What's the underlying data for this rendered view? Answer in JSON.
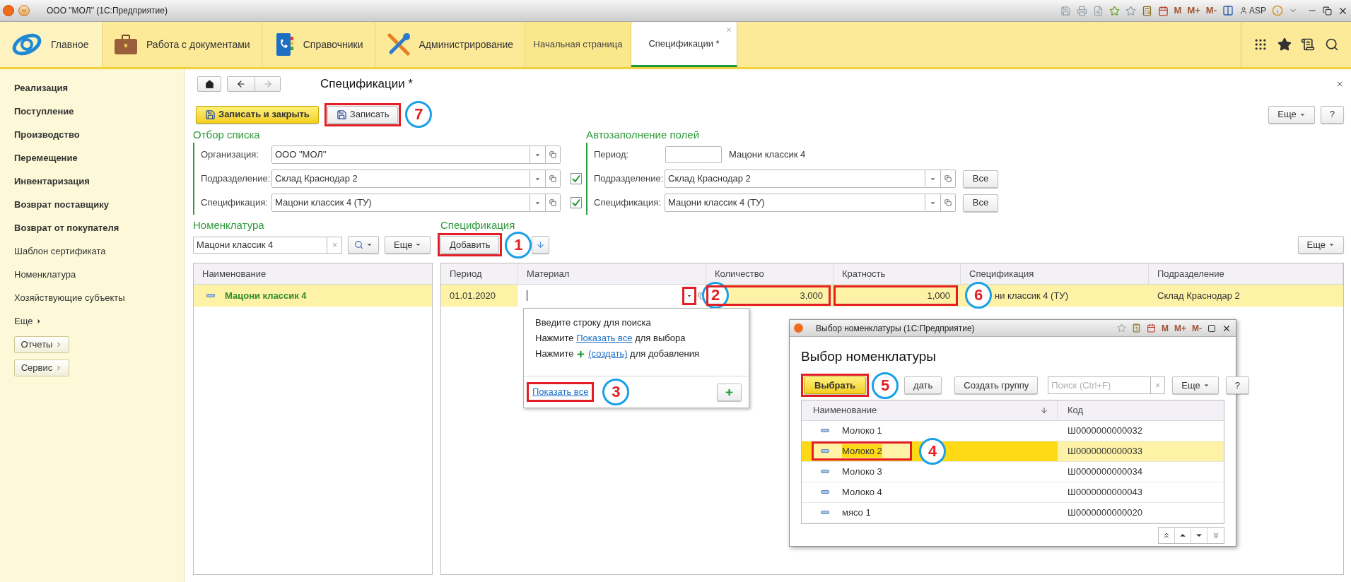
{
  "window": {
    "title": "ООО \"МОЛ\"  (1С:Предприятие)",
    "memory_buttons": [
      "M",
      "M+",
      "M-"
    ],
    "user": "ASP"
  },
  "sections": [
    {
      "label": "Главное",
      "kind": "home",
      "selected": true
    },
    {
      "label": "Работа с документами",
      "kind": "briefcase",
      "selected": false
    },
    {
      "label": "Справочники",
      "kind": "book",
      "selected": false
    },
    {
      "label": "Администрирование",
      "kind": "tools",
      "selected": false
    }
  ],
  "open_tabs": [
    {
      "label": "Начальная страница",
      "selected": false
    },
    {
      "label": "Спецификации *",
      "selected": true
    }
  ],
  "sidebar": {
    "items": [
      {
        "label": "Реализация",
        "kind": "section"
      },
      {
        "label": "Поступление",
        "kind": "section"
      },
      {
        "label": "Производство",
        "kind": "section"
      },
      {
        "label": "Перемещение",
        "kind": "section"
      },
      {
        "label": "Инвентаризация",
        "kind": "section"
      },
      {
        "label": "Возврат поставщику",
        "kind": "section"
      },
      {
        "label": "Возврат от покупателя",
        "kind": "section"
      },
      {
        "label": "Шаблон сертификата",
        "kind": "link"
      },
      {
        "label": "Номенклатура",
        "kind": "link"
      },
      {
        "label": "Хозяйствующие субъекты",
        "kind": "link"
      },
      {
        "label": "Еще",
        "kind": "more"
      },
      {
        "label": "Отчеты",
        "kind": "button"
      },
      {
        "label": "Сервис",
        "kind": "button"
      }
    ]
  },
  "form": {
    "title": "Спецификации *",
    "commands": [
      {
        "label": "Записать и закрыть",
        "kind": "default",
        "marked": false
      },
      {
        "label": "Записать",
        "kind": "normal",
        "marked": true,
        "callout": "7"
      }
    ],
    "more": "Еще",
    "help": "?"
  },
  "filter": {
    "title": "Отбор списка",
    "fields": [
      {
        "label": "Организация:",
        "value": "ООО \"МОЛ\"",
        "kind": "plain"
      },
      {
        "label": "Подразделение:",
        "value": "Склад Краснодар 2",
        "kind": "checkbox",
        "checked": true
      },
      {
        "label": "Спецификация:",
        "value": "Мацони классик 4 (ТУ)",
        "kind": "checkbox",
        "checked": true
      }
    ]
  },
  "autofill": {
    "title": "Автозаполнение полей",
    "period": {
      "label": "Период:",
      "note": "Мацони классик 4"
    },
    "fields": [
      {
        "label": "Подразделение:",
        "value": "Склад Краснодар 2",
        "button": "Все"
      },
      {
        "label": "Спецификация:",
        "value": "Мацони классик 4 (ТУ)",
        "button": "Все"
      }
    ]
  },
  "nomenclature": {
    "title": "Номенклатура",
    "search": {
      "value": "Мацони классик 4"
    },
    "more": "Еще",
    "columns": [
      "Наименование"
    ],
    "rows": [
      {
        "name": "Мацони классик 4",
        "selected": true
      }
    ]
  },
  "specification": {
    "title": "Спецификация",
    "add": {
      "label": "Добавить",
      "marked": true,
      "callout": "1"
    },
    "more": "Еще",
    "columns": [
      "Период",
      "Материал",
      "Количество",
      "Кратность",
      "Спецификация",
      "Подразделение"
    ],
    "rows": [
      {
        "selected": true,
        "cells": [
          {
            "kind": "text",
            "text": "01.01.2020",
            "marked": false
          },
          {
            "kind": "input",
            "editing": true,
            "button_marked": true,
            "callout": "2"
          },
          {
            "kind": "number",
            "text": "3,000",
            "marked": true
          },
          {
            "kind": "number",
            "text": "1,000",
            "marked": true
          },
          {
            "kind": "text",
            "text": "ни классик 4 (ТУ)",
            "marked": false,
            "callout": "6"
          },
          {
            "kind": "text",
            "text": "Склад Краснодар 2",
            "marked": false
          }
        ]
      }
    ]
  },
  "dropdown": {
    "lines": [
      [
        {
          "kind": "text",
          "text": "Введите строку для поиска"
        }
      ],
      [
        {
          "kind": "text",
          "text": "Нажмите "
        },
        {
          "kind": "link",
          "text": "Показать все"
        },
        {
          "kind": "text",
          "text": " для выбора"
        }
      ],
      [
        {
          "kind": "text",
          "text": "Нажмите "
        },
        {
          "kind": "plus"
        },
        {
          "kind": "link",
          "text": "(создать)"
        },
        {
          "kind": "text",
          "text": " для добавления"
        }
      ]
    ],
    "footer_link": {
      "text": "Показать все",
      "marked": true,
      "callout": "3"
    }
  },
  "dialog": {
    "window_title": "Выбор номенклатуры  (1С:Предприятие)",
    "memory_buttons": [
      "M",
      "M+",
      "M-"
    ],
    "title": "Выбор номенклатуры",
    "buttons": [
      {
        "label": "Выбрать",
        "kind": "default",
        "marked": true,
        "callout": "5"
      },
      {
        "label": "дать",
        "kind": "normal",
        "marked": false
      },
      {
        "label": "Создать группу",
        "kind": "normal",
        "marked": false
      }
    ],
    "search": {
      "placeholder": "Поиск (Ctrl+F)"
    },
    "more": "Еще",
    "help": "?",
    "columns": [
      "Наименование",
      "Код"
    ],
    "rows": [
      {
        "name": "Молоко 1",
        "code": "Ш0000000000032",
        "selected": false,
        "marked": false
      },
      {
        "name": "Молоко 2",
        "code": "Ш0000000000033",
        "selected": true,
        "marked": true,
        "callout": "4"
      },
      {
        "name": "Молоко 3",
        "code": "Ш0000000000034",
        "selected": false,
        "marked": false
      },
      {
        "name": "Молоко 4",
        "code": "Ш0000000000043",
        "selected": false,
        "marked": false
      },
      {
        "name": "мясо 1",
        "code": "Ш0000000000020",
        "selected": false,
        "marked": false
      }
    ]
  }
}
